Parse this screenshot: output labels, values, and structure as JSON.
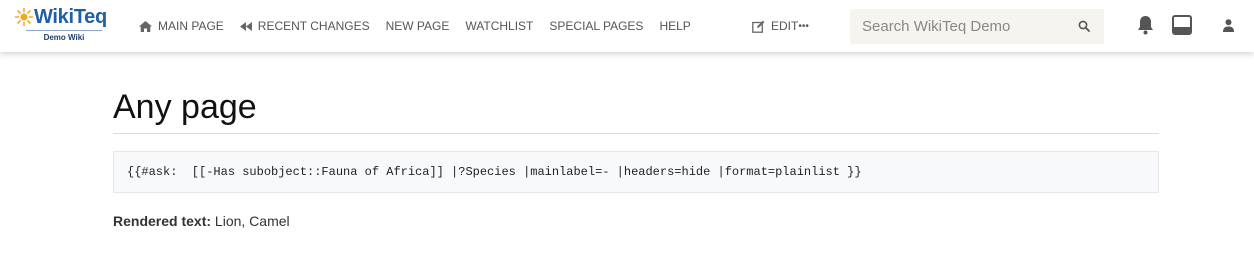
{
  "logo": {
    "name": "WikiTeq",
    "subtitle": "Demo Wiki"
  },
  "nav": {
    "items": [
      {
        "label": "Main page",
        "icon": "home-icon"
      },
      {
        "label": "Recent changes",
        "icon": "backward-icon"
      },
      {
        "label": "New page"
      },
      {
        "label": "Watchlist"
      },
      {
        "label": "Special pages"
      },
      {
        "label": "Help"
      }
    ],
    "edit_label": "EDIT",
    "edit_more": "•••"
  },
  "search": {
    "placeholder": "Search WikiTeq Demo",
    "value": ""
  },
  "page": {
    "title": "Any page",
    "code": "{{#ask:  [[-Has subobject::Fauna of Africa]] |?Species |mainlabel=- |headers=hide |format=plainlist }}",
    "rendered_label": "Rendered text:",
    "rendered_value": " Lion, Camel"
  },
  "colors": {
    "brand": "#1f5fa8",
    "nav_text": "#555555",
    "search_bg": "#f6f4ee",
    "code_bg": "#f8f9fa"
  }
}
